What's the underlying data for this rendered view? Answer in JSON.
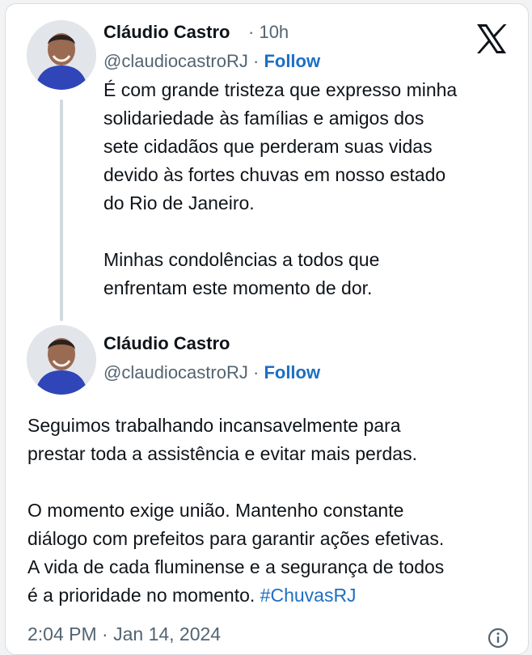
{
  "tweet1": {
    "author_name": "Cláudio Castro",
    "separator": "·",
    "time_ago": "10h",
    "handle": "@claudiocastroRJ",
    "follow_label": "Follow",
    "text": "É com grande tristeza que expresso minha\nsolidariedade às famílias e amigos dos\nsete cidadãos que perderam suas vidas\ndevido às fortes chuvas em nosso estado\ndo Rio de Janeiro.\n\nMinhas condolências a todos que\nenfrentam este momento de dor."
  },
  "tweet2": {
    "author_name": "Cláudio Castro",
    "separator": "·",
    "handle": "@claudiocastroRJ",
    "follow_label": "Follow",
    "text": "Seguimos trabalhando incansavelmente para\nprestar toda a assistência e evitar mais perdas.\n\nO momento exige união. Mantenho constante\ndiálogo com prefeitos para garantir ações efetivas.\nA vida de cada fluminense e a segurança de todos\né a prioridade no momento. ",
    "hashtag": "#ChuvasRJ"
  },
  "footer": {
    "timestamp": "2:04 PM · Jan 14, 2024"
  },
  "icons": {
    "brand": "x-logo-icon",
    "info": "info-icon"
  },
  "colors": {
    "link": "#1d6fc4",
    "secondary_text": "#536471",
    "thread_line": "#cfd9de"
  }
}
